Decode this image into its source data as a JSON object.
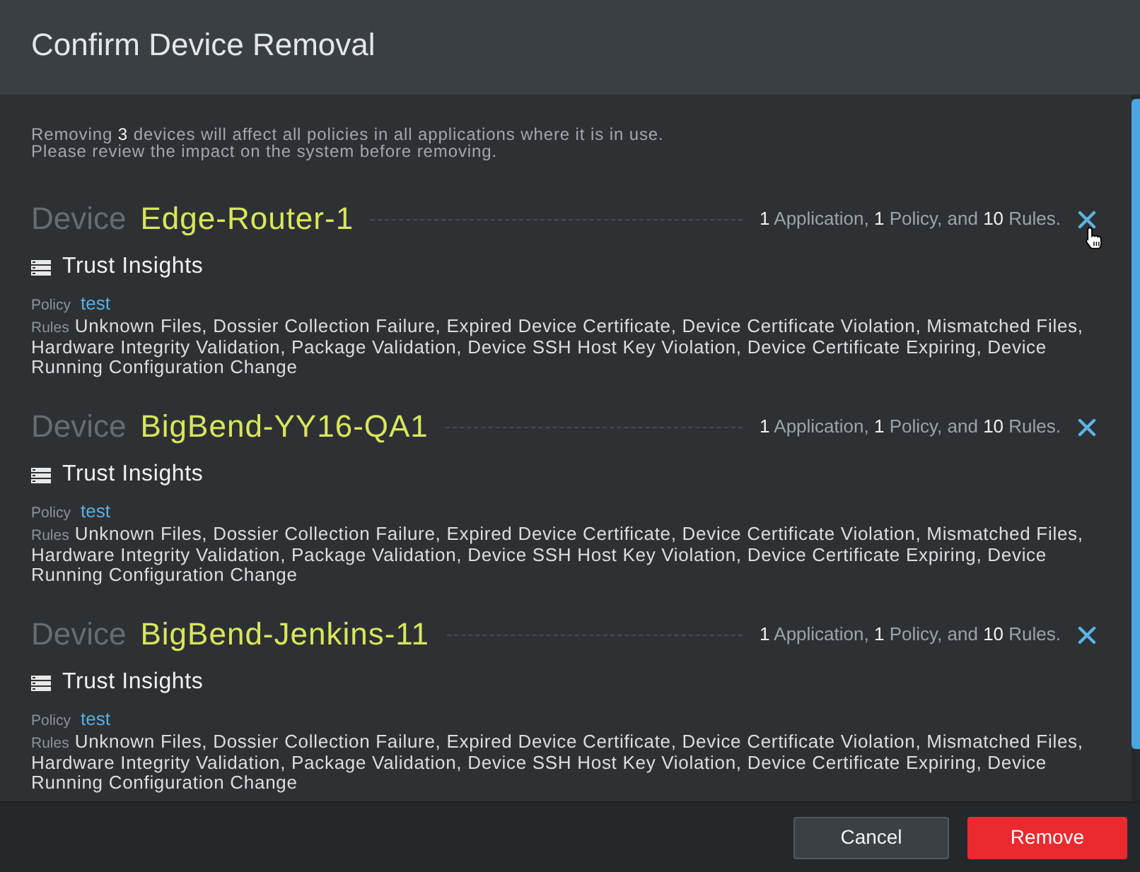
{
  "dialog": {
    "title": "Confirm Device Removal"
  },
  "intro": [
    "Removing **3** devices will affect all policies in all applications where it is in use.",
    "Please review the impact on the system before removing."
  ],
  "devices": [
    {
      "label": "Device",
      "name": "Edge-Router-1",
      "summary": "**1** Application, **1** Policy, and **10** Rules.",
      "hover": true,
      "groups": [
        {
          "title": "Trust Insights",
          "policy_label": "Policy",
          "policy": "test",
          "rules_label": "Rules",
          "rules": "Unknown Files, Dossier Collection Failure, Expired Device Certificate, Device Certificate Violation, Mismatched Files, Hardware Integrity Validation, Package Validation, Device SSH Host Key Violation, Device Certificate Expiring, Device Running Configuration Change"
        }
      ]
    },
    {
      "label": "Device",
      "name": "BigBend-YY16-QA1",
      "summary": "**1** Application, **1** Policy, and **10** Rules.",
      "hover": false,
      "groups": [
        {
          "title": "Trust Insights",
          "policy_label": "Policy",
          "policy": "test",
          "rules_label": "Rules",
          "rules": "Unknown Files, Dossier Collection Failure, Expired Device Certificate, Device Certificate Violation, Mismatched Files, Hardware Integrity Validation, Package Validation, Device SSH Host Key Violation, Device Certificate Expiring, Device Running Configuration Change"
        }
      ]
    },
    {
      "label": "Device",
      "name": "BigBend-Jenkins-11",
      "summary": "**1** Application, **1** Policy, and **10** Rules.",
      "hover": false,
      "groups": [
        {
          "title": "Trust Insights",
          "policy_label": "Policy",
          "policy": "test",
          "rules_label": "Rules",
          "rules": "Unknown Files, Dossier Collection Failure, Expired Device Certificate, Device Certificate Violation, Mismatched Files, Hardware Integrity Validation, Package Validation, Device SSH Host Key Violation, Device Certificate Expiring, Device Running Configuration Change"
        }
      ]
    }
  ],
  "buttons": [
    {
      "label": "Cancel",
      "kind": "secondary"
    },
    {
      "label": "Remove",
      "kind": "danger"
    }
  ]
}
